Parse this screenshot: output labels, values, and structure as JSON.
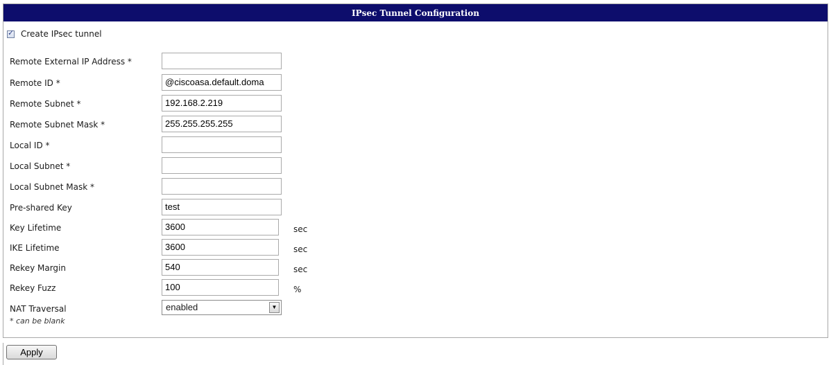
{
  "title": "IPsec Tunnel Configuration",
  "create_tunnel": {
    "label": "Create IPsec tunnel",
    "checked": true
  },
  "fields": {
    "remote_ext_ip": {
      "label": "Remote External IP Address *",
      "value": ""
    },
    "remote_id": {
      "label": "Remote ID *",
      "value": "@ciscoasa.default.doma"
    },
    "remote_subnet": {
      "label": "Remote Subnet *",
      "value": "192.168.2.219"
    },
    "remote_subnet_mask": {
      "label": "Remote Subnet Mask *",
      "value": "255.255.255.255"
    },
    "local_id": {
      "label": "Local ID *",
      "value": ""
    },
    "local_subnet": {
      "label": "Local Subnet *",
      "value": ""
    },
    "local_subnet_mask": {
      "label": "Local Subnet Mask *",
      "value": ""
    },
    "psk": {
      "label": "Pre-shared Key",
      "value": "test"
    },
    "key_lifetime": {
      "label": "Key Lifetime",
      "value": "3600",
      "unit": "sec"
    },
    "ike_lifetime": {
      "label": "IKE Lifetime",
      "value": "3600",
      "unit": "sec"
    },
    "rekey_margin": {
      "label": "Rekey Margin",
      "value": "540",
      "unit": "sec"
    },
    "rekey_fuzz": {
      "label": "Rekey Fuzz",
      "value": "100",
      "unit": "%"
    },
    "nat_traversal": {
      "label": "NAT Traversal",
      "value": "enabled"
    }
  },
  "hint": "* can be blank",
  "apply_label": "Apply",
  "colors": {
    "title_bar": "#0d0d6c",
    "title_text": "#ffffff",
    "border": "#a8a8a8"
  }
}
